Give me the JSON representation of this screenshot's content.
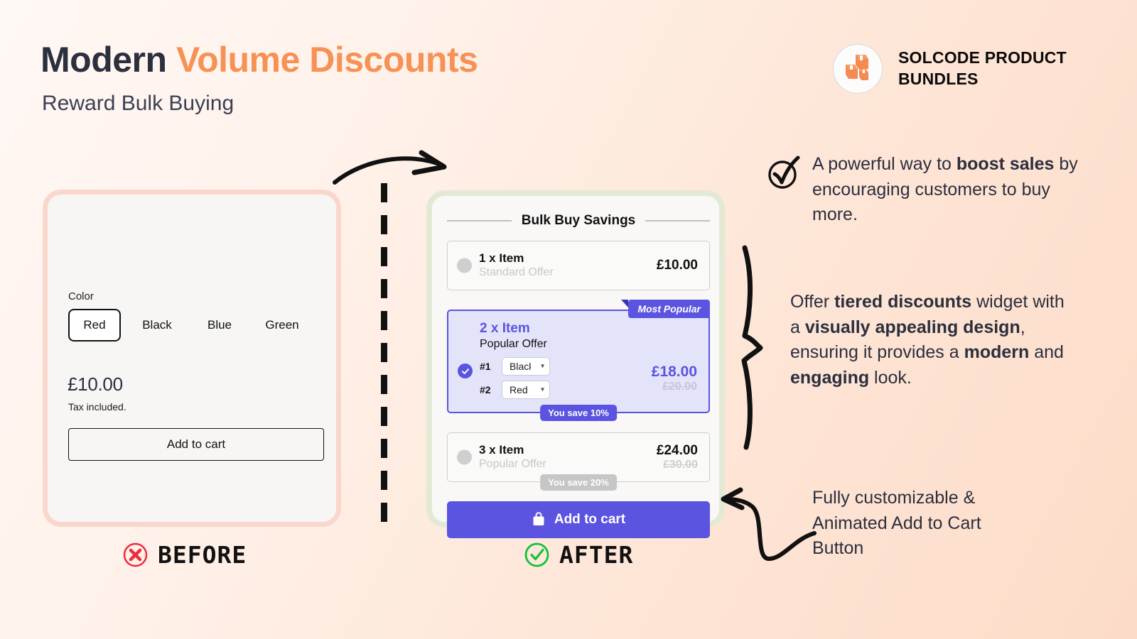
{
  "header": {
    "title_plain": "Modern ",
    "title_accent": "Volume Discounts",
    "subtitle": "Reward Bulk Buying",
    "accent_color": "#F79154"
  },
  "brand": {
    "logo_icon": "boxes-logo-icon",
    "line1": "SOLCODE PRODUCT",
    "line2": "BUNDLES"
  },
  "before": {
    "label": "BEFORE",
    "status_icon": "cross-circle-icon",
    "option_label": "Color",
    "swatches": [
      {
        "label": "Red",
        "selected": true
      },
      {
        "label": "Black",
        "selected": false
      },
      {
        "label": "Blue",
        "selected": false
      },
      {
        "label": "Green",
        "selected": false
      }
    ],
    "price": "£10.00",
    "tax_note": "Tax included.",
    "add_to_cart": "Add to cart"
  },
  "after": {
    "label": "AFTER",
    "status_icon": "check-circle-icon",
    "widget_title": "Bulk Buy Savings",
    "accent_color": "#5A54E0",
    "tiers": [
      {
        "qty": "1 x Item",
        "offer": "Standard Offer",
        "price": "£10.00",
        "was": "",
        "save": "",
        "badge": "",
        "selected": false,
        "variants": []
      },
      {
        "qty": "2 x Item",
        "offer": "Popular Offer",
        "price": "£18.00",
        "was": "£20.00",
        "save": "You save 10%",
        "badge": "Most Popular",
        "selected": true,
        "variants": [
          {
            "num": "#1",
            "value": "Black"
          },
          {
            "num": "#2",
            "value": "Red"
          }
        ]
      },
      {
        "qty": "3 x Item",
        "offer": "Popular Offer",
        "price": "£24.00",
        "was": "£30.00",
        "save": "You save 20%",
        "badge": "",
        "selected": false,
        "variants": []
      }
    ],
    "variant_options": [
      "Red",
      "Black",
      "Blue",
      "Green"
    ],
    "add_to_cart": "Add to cart",
    "cart_icon": "shopping-bag-icon"
  },
  "notes": {
    "note1_a": "A powerful way to ",
    "note1_b": "boost sales",
    "note1_c": " by encouraging customers to buy more.",
    "note2_a": "Offer ",
    "note2_b": "tiered discounts",
    "note2_c": " widget with a ",
    "note2_d": "visually appealing design",
    "note2_e": ", ensuring it provides a ",
    "note2_f": "modern",
    "note2_g": " and ",
    "note2_h": "engaging",
    "note2_i": " look.",
    "note3": "Fully customizable & Animated Add to Cart Button"
  }
}
